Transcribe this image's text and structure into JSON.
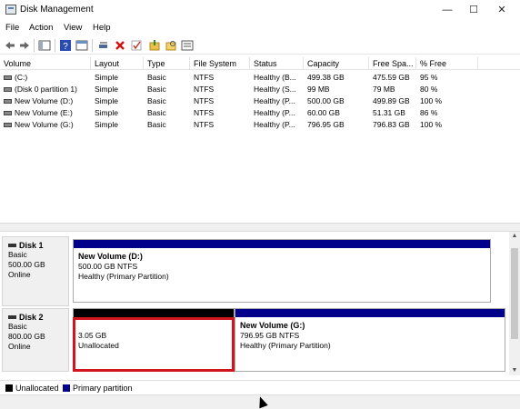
{
  "window": {
    "title": "Disk Management",
    "minimize_glyph": "—",
    "maximize_glyph": "☐",
    "close_glyph": "✕"
  },
  "menu": [
    {
      "label": "File"
    },
    {
      "label": "Action"
    },
    {
      "label": "View"
    },
    {
      "label": "Help"
    }
  ],
  "toolbar": [
    "back-icon",
    "forward-icon",
    "console-tree-icon",
    "help-icon",
    "properties-icon",
    "connect-icon",
    "delete-icon",
    "checkmark-icon",
    "open-folder-icon",
    "explore-icon",
    "list-view-icon"
  ],
  "columns": [
    {
      "label": "Volume"
    },
    {
      "label": "Layout"
    },
    {
      "label": "Type"
    },
    {
      "label": "File System"
    },
    {
      "label": "Status"
    },
    {
      "label": "Capacity"
    },
    {
      "label": "Free Spa..."
    },
    {
      "label": "% Free"
    }
  ],
  "volumes": [
    {
      "volume": "(C:)",
      "layout": "Simple",
      "type": "Basic",
      "fs": "NTFS",
      "status": "Healthy (B...",
      "capacity": "499.38 GB",
      "free": "475.59 GB",
      "pct": "95 %"
    },
    {
      "volume": "(Disk 0 partition 1)",
      "layout": "Simple",
      "type": "Basic",
      "fs": "NTFS",
      "status": "Healthy (S...",
      "capacity": "99 MB",
      "free": "79 MB",
      "pct": "80 %"
    },
    {
      "volume": "New Volume (D:)",
      "layout": "Simple",
      "type": "Basic",
      "fs": "NTFS",
      "status": "Healthy (P...",
      "capacity": "500.00 GB",
      "free": "499.89 GB",
      "pct": "100 %"
    },
    {
      "volume": "New Volume (E:)",
      "layout": "Simple",
      "type": "Basic",
      "fs": "NTFS",
      "status": "Healthy (P...",
      "capacity": "60.00 GB",
      "free": "51.31 GB",
      "pct": "86 %"
    },
    {
      "volume": "New Volume (G:)",
      "layout": "Simple",
      "type": "Basic",
      "fs": "NTFS",
      "status": "Healthy (P...",
      "capacity": "796.95 GB",
      "free": "796.83 GB",
      "pct": "100 %"
    }
  ],
  "disks": [
    {
      "name": "Disk 1",
      "type": "Basic",
      "size": "500.00 GB",
      "state": "Online",
      "partitions": [
        {
          "title": "New Volume  (D:)",
          "size_fs": "500.00 GB NTFS",
          "status": "Healthy (Primary Partition)",
          "kind": "primary"
        }
      ]
    },
    {
      "name": "Disk 2",
      "type": "Basic",
      "size": "800.00 GB",
      "state": "Online",
      "partitions": [
        {
          "title": "",
          "size_fs": "3.05 GB",
          "status": "Unallocated",
          "kind": "unallocated",
          "selected": true
        },
        {
          "title": "New Volume  (G:)",
          "size_fs": "796.95 GB NTFS",
          "status": "Healthy (Primary Partition)",
          "kind": "primary"
        }
      ]
    }
  ],
  "legend": [
    {
      "label": "Unallocated",
      "color": "#000000"
    },
    {
      "label": "Primary partition",
      "color": "#00008b"
    }
  ],
  "colors": {
    "primary_bar": "#00008b",
    "unallocated_bar": "#000000",
    "selection": "#d0151f"
  }
}
